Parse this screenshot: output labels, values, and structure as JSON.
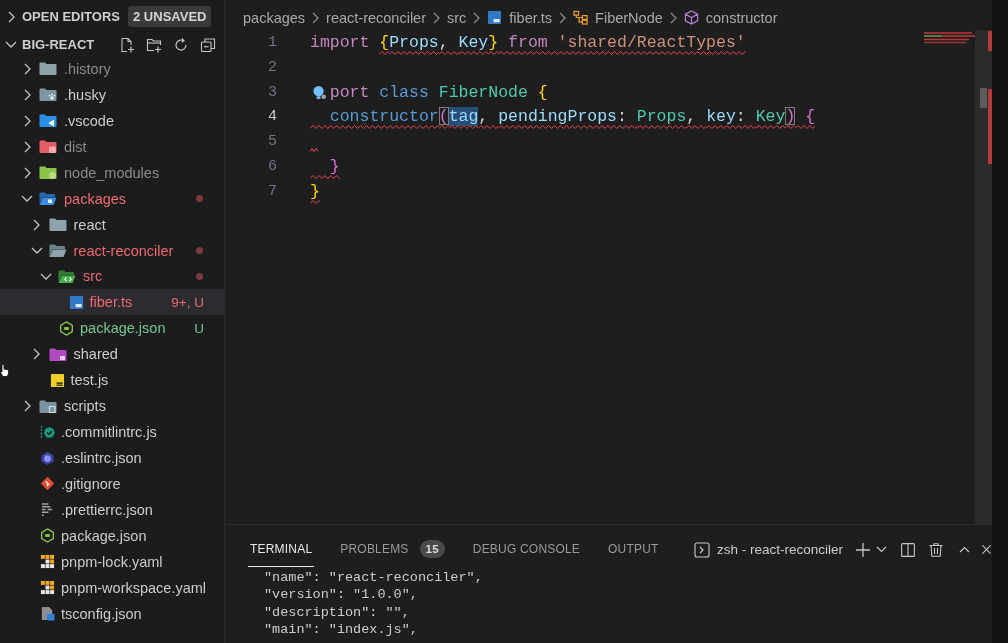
{
  "sidebar": {
    "open_editors": {
      "title": "OPEN EDITORS",
      "expanded": false,
      "badge": "2 UNSAVED"
    },
    "explorer": {
      "title": "BIG-REACT",
      "expanded": true
    },
    "tree": [
      {
        "name": ".history",
        "kind": "folder",
        "expanded": false,
        "color": "#8a8a8a",
        "selected": false
      },
      {
        "name": ".husky",
        "kind": "husky",
        "expanded": false,
        "color": "#cccccc",
        "selected": false
      },
      {
        "name": ".vscode",
        "kind": "vscode",
        "expanded": false,
        "color": "#cccccc",
        "selected": false
      },
      {
        "name": "dist",
        "kind": "dist",
        "expanded": false,
        "color": "#8a8a8a",
        "selected": false
      },
      {
        "name": "node_modules",
        "kind": "modules",
        "expanded": false,
        "color": "#8a8a8a",
        "selected": false
      },
      {
        "name": "packages",
        "kind": "packages",
        "expanded": true,
        "color": "#ee6a72",
        "selected": false,
        "dot": true,
        "children": [
          {
            "name": "react",
            "kind": "folder",
            "expanded": false,
            "color": "#cccccc",
            "selected": false
          },
          {
            "name": "react-reconciler",
            "kind": "folder",
            "expanded": true,
            "color": "#ee6a72",
            "selected": false,
            "dot": true,
            "children": [
              {
                "name": "src",
                "kind": "source",
                "expanded": true,
                "color": "#ee6a72",
                "selected": false,
                "dot": true,
                "children": [
                  {
                    "name": "fiber.ts",
                    "kind": "typescript",
                    "color": "#ee6a72",
                    "selected": true,
                    "badge": "9+, U"
                  }
                ]
              },
              {
                "name": "package.json",
                "kind": "nodejs",
                "color": "#73c991",
                "selected": false,
                "badge": "U"
              }
            ]
          },
          {
            "name": "shared",
            "kind": "shared",
            "expanded": false,
            "color": "#cccccc",
            "selected": false
          },
          {
            "name": "test.js",
            "kind": "javascript",
            "color": "#cccccc",
            "selected": false
          }
        ]
      },
      {
        "name": "scripts",
        "kind": "scripts",
        "expanded": false,
        "color": "#cccccc",
        "selected": false
      },
      {
        "name": ".commitlintrc.js",
        "kind": "commitlint",
        "color": "#cccccc",
        "selected": false
      },
      {
        "name": ".eslintrc.json",
        "kind": "eslint",
        "color": "#cccccc",
        "selected": false
      },
      {
        "name": ".gitignore",
        "kind": "git",
        "color": "#cccccc",
        "selected": false
      },
      {
        "name": ".prettierrc.json",
        "kind": "prettier",
        "color": "#cccccc",
        "selected": false
      },
      {
        "name": "package.json",
        "kind": "nodejs",
        "color": "#cccccc",
        "selected": false
      },
      {
        "name": "pnpm-lock.yaml",
        "kind": "pnpm",
        "color": "#cccccc",
        "selected": false
      },
      {
        "name": "pnpm-workspace.yaml",
        "kind": "pnpm",
        "color": "#cccccc",
        "selected": false
      },
      {
        "name": "tsconfig.json",
        "kind": "tsconfig",
        "color": "#cccccc",
        "selected": false
      }
    ]
  },
  "editor": {
    "breadcrumbs": [
      {
        "text": "packages",
        "kind": "folder"
      },
      {
        "text": "react-reconciler",
        "kind": "folder"
      },
      {
        "text": "src",
        "kind": "folder"
      },
      {
        "text": "fiber.ts",
        "kind": "typescript"
      },
      {
        "text": "FiberNode",
        "kind": "class"
      },
      {
        "text": "constructor",
        "kind": "method"
      }
    ],
    "lines": [
      {
        "number": "1",
        "active": false,
        "tokens": [
          {
            "text": "import ",
            "kind": "keyword"
          },
          {
            "text": "{",
            "kind": "bracket1",
            "squiggle": true
          },
          {
            "text": "Props",
            "kind": "variable",
            "squiggle": true
          },
          {
            "text": ", ",
            "kind": "punctuation",
            "squiggle": true
          },
          {
            "text": "Key",
            "kind": "variable",
            "squiggle": true
          },
          {
            "text": "}",
            "kind": "bracket1",
            "squiggle": true
          },
          {
            "text": " from ",
            "kind": "keyword",
            "squiggle": true
          },
          {
            "text": "'shared/ReactTypes'",
            "kind": "string",
            "squiggle": true
          }
        ]
      },
      {
        "number": "2",
        "active": false
      },
      {
        "number": "3",
        "active": false,
        "lightbulb": true,
        "tokens": [
          {
            "text": "port ",
            "kind": "keyword"
          },
          {
            "text": "class ",
            "kind": "storage"
          },
          {
            "text": "FiberNode ",
            "kind": "type"
          },
          {
            "text": "{",
            "kind": "bracket1"
          }
        ]
      },
      {
        "number": "4",
        "active": true,
        "tokens": [
          {
            "text": "  constructor",
            "kind": "storage",
            "squiggle": true
          },
          {
            "text": "(",
            "kind": "bracket2",
            "squiggle": true,
            "matched": true
          },
          {
            "text": "tag",
            "kind": "parameter",
            "squiggle": true,
            "highlighted": true
          },
          {
            "text": ", ",
            "kind": "punctuation",
            "squiggle": true
          },
          {
            "text": "pendingProps",
            "kind": "parameter",
            "squiggle": true
          },
          {
            "text": ": ",
            "kind": "punctuation",
            "squiggle": true
          },
          {
            "text": "Props",
            "kind": "type",
            "squiggle": true
          },
          {
            "text": ", ",
            "kind": "punctuation",
            "squiggle": true
          },
          {
            "text": "key",
            "kind": "parameter",
            "squiggle": true
          },
          {
            "text": ": ",
            "kind": "punctuation",
            "squiggle": true
          },
          {
            "text": "Key",
            "kind": "type",
            "squiggle": true
          },
          {
            "text": ")",
            "kind": "bracket2",
            "squiggle": true,
            "matched": true
          },
          {
            "text": " {",
            "kind": "bracket2",
            "squiggle": true
          }
        ]
      },
      {
        "number": "5",
        "active": false,
        "squiggle": true
      },
      {
        "number": "6",
        "active": false,
        "tokens": [
          {
            "text": "  }",
            "kind": "bracket2",
            "squiggle": true
          }
        ]
      },
      {
        "number": "7",
        "active": false,
        "tokens": [
          {
            "text": "}",
            "kind": "bracket1",
            "squiggle": true
          }
        ]
      }
    ]
  },
  "panel": {
    "tabs": [
      {
        "label": "TERMINAL",
        "selected": true
      },
      {
        "label": "PROBLEMS",
        "selected": false,
        "badge": "15"
      },
      {
        "label": "DEBUG CONSOLE",
        "selected": false
      },
      {
        "label": "OUTPUT",
        "selected": false
      }
    ],
    "terminal": {
      "name": "zsh - react-reconciler"
    },
    "output": [
      "\"name\": \"react-reconciler\",",
      "\"version\": \"1.0.0\",",
      "\"description\": \"\",",
      "\"main\": \"index.js\","
    ]
  }
}
